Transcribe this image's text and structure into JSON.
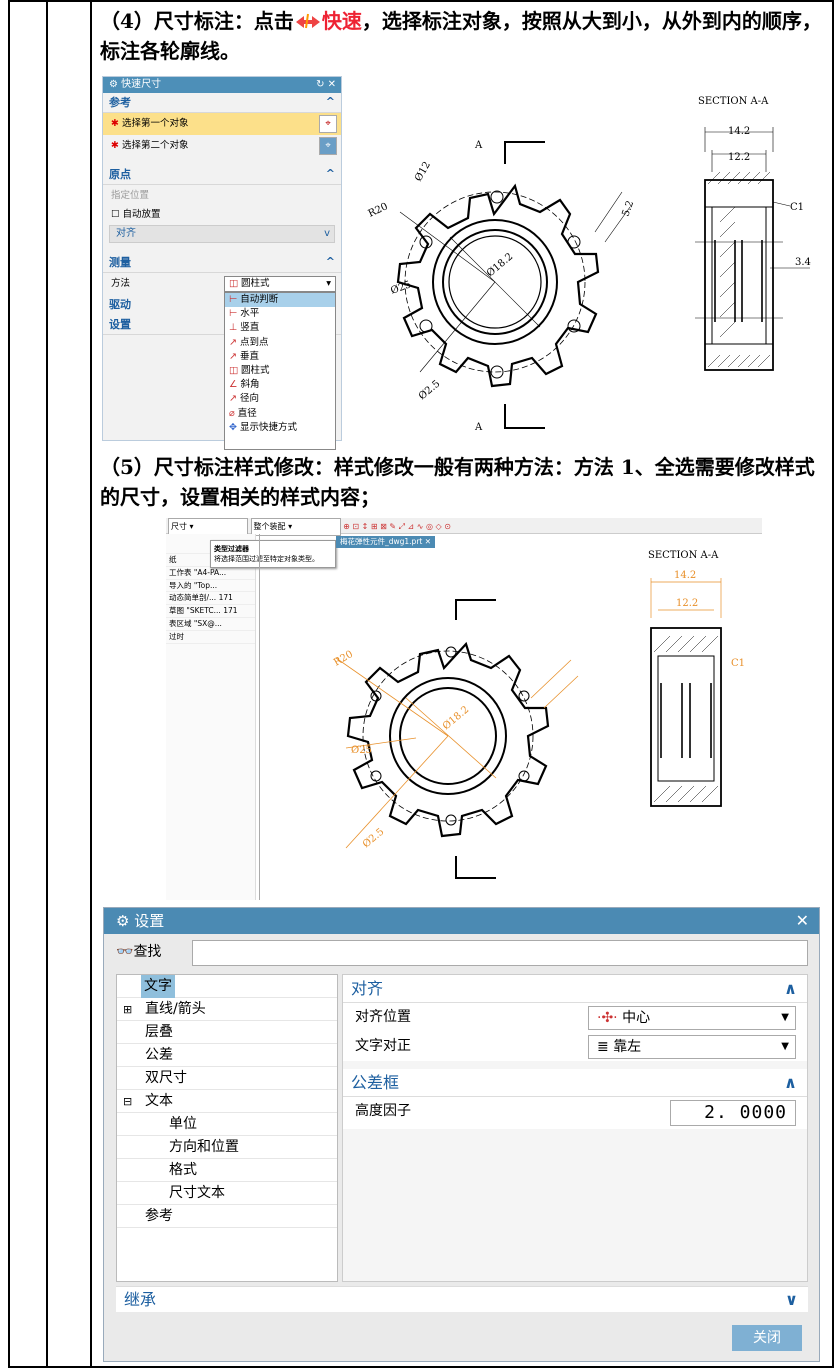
{
  "step4": {
    "prefix": "（4）尺寸标注：点击",
    "quick_label": "快速",
    "suffix": "，选择标注对象，按照从大到小，从外到内的顺序，标注各轮廓线。"
  },
  "quick_dialog": {
    "title": "快速尺寸",
    "sections": {
      "ref": "参考",
      "origin": "原点",
      "measure": "测量",
      "drive": "驱动",
      "settings": "设置"
    },
    "first_obj": "选择第一个对象",
    "second_obj": "选择第二个对象",
    "specify_pos": "指定位置",
    "auto_place": "自动放置",
    "align": "对齐",
    "method_label": "方法",
    "method_value": "圆柱式",
    "options": [
      "自动判断",
      "水平",
      "竖直",
      "点到点",
      "垂直",
      "圆柱式",
      "斜角",
      "径向",
      "直径",
      "显示快捷方式"
    ]
  },
  "drawing1": {
    "section_title": "SECTION A-A",
    "dims": [
      "14.2",
      "12.2",
      "C1",
      "3.4",
      "R20",
      "Ø12",
      "Ø18.2",
      "Ø25",
      "Ø2.5",
      "5.2"
    ],
    "section_mark": "A"
  },
  "step5": {
    "text": "（5）尺寸标注样式修改：样式修改一般有两种方法：方法 1、全选需要修改样式的尺寸，设置相关的样式内容；"
  },
  "screenshot2": {
    "toolbar": [
      "尺寸",
      "整个装配"
    ],
    "tooltip_title": "类型过滤器",
    "tooltip_text": "将选择范围过滤至特定对象类型。",
    "tab": "梅花弹性元件_dwg1.prt",
    "tree": [
      "纸",
      "工作表 \"A4-PA...",
      "导入的 \"Top...",
      "动态简单剖/...",
      "草图 \"SKETC...",
      "表区域 \"SX@...",
      "过时"
    ],
    "tree_nums": [
      "",
      "",
      "",
      "171",
      "171",
      "",
      ""
    ],
    "section_title": "SECTION A-A"
  },
  "settings_dialog": {
    "title": "设置",
    "find_label": "查找",
    "tree": [
      {
        "label": "文字",
        "indent": 1,
        "selected": true
      },
      {
        "label": "直线/箭头",
        "indent": 1,
        "expander": "+"
      },
      {
        "label": "层叠",
        "indent": 1
      },
      {
        "label": "公差",
        "indent": 1
      },
      {
        "label": "双尺寸",
        "indent": 1
      },
      {
        "label": "文本",
        "indent": 1,
        "expander": "−"
      },
      {
        "label": "单位",
        "indent": 2
      },
      {
        "label": "方向和位置",
        "indent": 2
      },
      {
        "label": "格式",
        "indent": 2
      },
      {
        "label": "尺寸文本",
        "indent": 2
      },
      {
        "label": "参考",
        "indent": 1
      }
    ],
    "align_section": "对齐",
    "align_pos_label": "对齐位置",
    "align_pos_value": "中心",
    "text_just_label": "文字对正",
    "text_just_value": "靠左",
    "tol_section": "公差框",
    "height_factor_label": "高度因子",
    "height_factor_value": "2. 0000",
    "inherit": "继承",
    "close": "关闭"
  }
}
